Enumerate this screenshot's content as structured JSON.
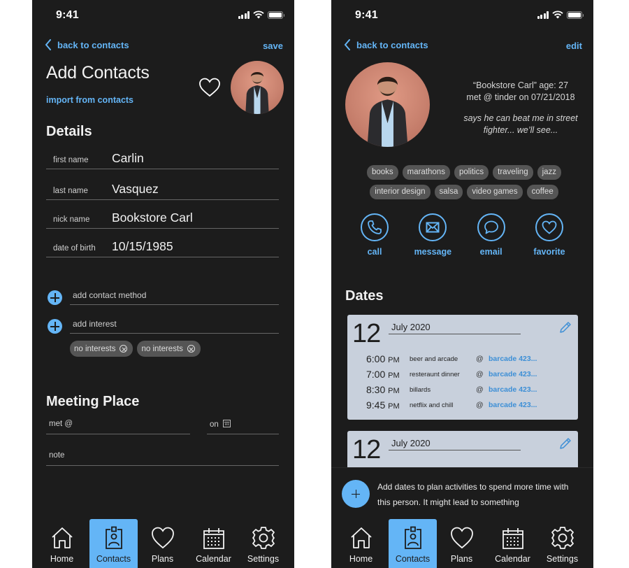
{
  "status_bar": {
    "time": "9:41"
  },
  "colors": {
    "accent": "#64b5f6",
    "background": "#1c1c1c",
    "card": "#c8d0dc",
    "chip": "#555555",
    "link": "#3d8fd6"
  },
  "add_contact": {
    "nav": {
      "back_label": "back to contacts",
      "action_label": "save"
    },
    "title": "Add Contacts",
    "import_label": "import from contacts",
    "favorite_icon": "heart-outline-icon",
    "details": {
      "title": "Details",
      "fields": [
        {
          "label": "first name",
          "value": "Carlin"
        },
        {
          "label": "last name",
          "value": "Vasquez"
        },
        {
          "label": "nick name",
          "value": "Bookstore Carl"
        },
        {
          "label": "date of birth",
          "value": "10/15/1985"
        }
      ]
    },
    "add_contact_method_placeholder": "add contact method",
    "add_interest_placeholder": "add interest",
    "interest_chips": [
      "no interests",
      "no interests"
    ],
    "meeting_place": {
      "title": "Meeting Place",
      "met_placeholder": "met @",
      "on_placeholder": "on",
      "note_placeholder": "note"
    }
  },
  "contact_detail": {
    "nav": {
      "back_label": "back to contacts",
      "action_label": "edit"
    },
    "info_line1": "“Bookstore Carl”  age: 27",
    "info_line2": "met @ tinder on 07/21/2018",
    "note": "says he can beat me in street fighter... we’ll see...",
    "tags_row1": [
      "books",
      "marathons",
      "politics",
      "traveling",
      "jazz"
    ],
    "tags_row2": [
      "interior design",
      "salsa",
      "video games",
      "coffee"
    ],
    "actions": [
      {
        "label": "call",
        "icon": "phone-icon"
      },
      {
        "label": "message",
        "icon": "envelope-icon"
      },
      {
        "label": "email",
        "icon": "speech-bubble-icon"
      },
      {
        "label": "favorite",
        "icon": "heart-icon"
      }
    ],
    "dates_title": "Dates",
    "date_cards": [
      {
        "day": "12",
        "month": "July 2020",
        "events": [
          {
            "time": "6:00",
            "ampm": "PM",
            "desc": "beer and arcade",
            "at": "@",
            "location": "barcade 423..."
          },
          {
            "time": "7:00",
            "ampm": "PM",
            "desc": "resteraunt dinner",
            "at": "@",
            "location": "barcade 423..."
          },
          {
            "time": "8:30",
            "ampm": "PM",
            "desc": "billards",
            "at": "@",
            "location": "barcade 423..."
          },
          {
            "time": "9:45",
            "ampm": "PM",
            "desc": "netflix and chill",
            "at": "@",
            "location": "barcade 423..."
          }
        ]
      },
      {
        "day": "12",
        "month": "July 2020",
        "events": []
      }
    ],
    "hint": "Add dates to plan activities to spend more time with this person. It might lead to something"
  },
  "tab_bar": {
    "tabs": [
      {
        "label": "Home",
        "icon": "home-icon"
      },
      {
        "label": "Contacts",
        "icon": "contact-badge-icon",
        "active": true
      },
      {
        "label": "Plans",
        "icon": "heart-icon"
      },
      {
        "label": "Calendar",
        "icon": "calendar-icon"
      },
      {
        "label": "Settings",
        "icon": "gear-icon"
      }
    ]
  }
}
